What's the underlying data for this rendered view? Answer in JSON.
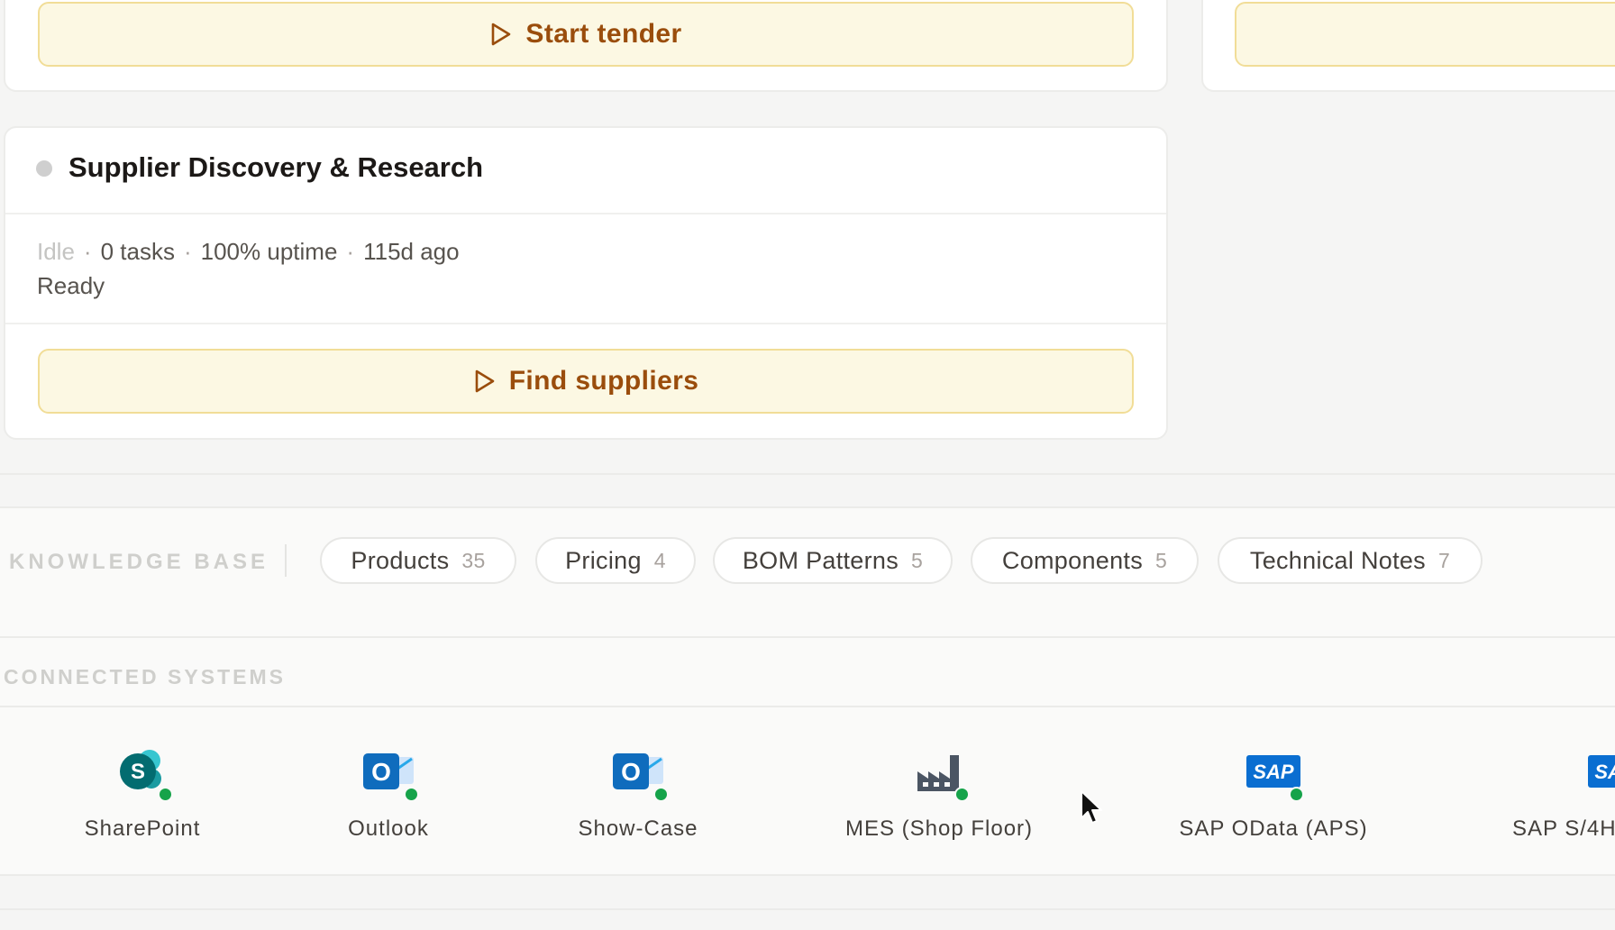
{
  "top_card": {
    "start_tender_label": "Start tender"
  },
  "agent_card": {
    "title": "Supplier Discovery & Research",
    "status": "Idle",
    "tasks": "0 tasks",
    "uptime": "100% uptime",
    "last_seen": "115d ago",
    "detail": "Ready",
    "action_label": "Find suppliers",
    "separator": "·"
  },
  "knowledge_base": {
    "label": "KNOWLEDGE BASE",
    "chips": [
      {
        "name": "Products",
        "count": "35"
      },
      {
        "name": "Pricing",
        "count": "4"
      },
      {
        "name": "BOM Patterns",
        "count": "5"
      },
      {
        "name": "Components",
        "count": "5"
      },
      {
        "name": "Technical Notes",
        "count": "7"
      }
    ]
  },
  "connected_systems": {
    "label": "CONNECTED SYSTEMS",
    "systems": [
      {
        "name": "SharePoint",
        "icon": "sharepoint-icon",
        "status": "online"
      },
      {
        "name": "Outlook",
        "icon": "outlook-icon",
        "status": "online"
      },
      {
        "name": "Show-Case",
        "icon": "outlook-icon",
        "status": "online"
      },
      {
        "name": "MES (Shop Floor)",
        "icon": "factory-icon",
        "status": "online"
      },
      {
        "name": "SAP OData (APS)",
        "icon": "sap-icon",
        "status": "online"
      },
      {
        "name": "SAP S/4H",
        "icon": "sap-icon",
        "status": "online"
      }
    ],
    "icon_texts": {
      "sharepoint": "S",
      "outlook": "O",
      "sap": "SAP"
    }
  },
  "colors": {
    "accent_amber": "#9a4d0c",
    "online_green": "#16a34a",
    "sharepoint_teal": "#036c70",
    "outlook_blue": "#0f6cbd",
    "sap_blue": "#0a6ed1"
  }
}
